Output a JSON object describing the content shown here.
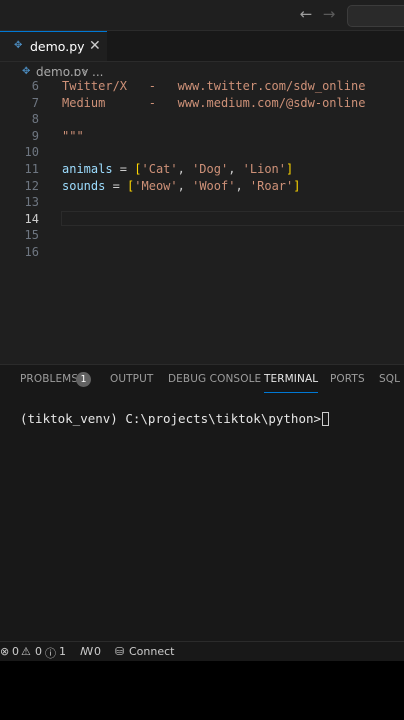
{
  "titlebar": {
    "back_icon": "←",
    "forward_icon": "→"
  },
  "tab": {
    "filename": "demo.py",
    "close_icon": "✕",
    "file_icon": "✥"
  },
  "breadcrumb": {
    "file": "demo.py",
    "separator": "›",
    "more": "..."
  },
  "editor": {
    "active_line": "14",
    "lines": [
      {
        "n": "6",
        "tokens": [
          {
            "c": "tk-doc",
            "t": "Twitter/X   -   www.twitter.com/sdw_online"
          }
        ]
      },
      {
        "n": "7",
        "tokens": [
          {
            "c": "tk-doc",
            "t": "Medium      -   www.medium.com/@sdw-online"
          }
        ]
      },
      {
        "n": "8",
        "tokens": []
      },
      {
        "n": "9",
        "tokens": [
          {
            "c": "tk-doc",
            "t": "\"\"\""
          }
        ]
      },
      {
        "n": "10",
        "tokens": []
      },
      {
        "n": "11",
        "tokens": [
          {
            "c": "tk-var",
            "t": "animals"
          },
          {
            "c": "tk-op",
            "t": " = "
          },
          {
            "c": "tk-br",
            "t": "["
          },
          {
            "c": "tk-str",
            "t": "'Cat'"
          },
          {
            "c": "tk-pun",
            "t": ", "
          },
          {
            "c": "tk-str",
            "t": "'Dog'"
          },
          {
            "c": "tk-pun",
            "t": ", "
          },
          {
            "c": "tk-str",
            "t": "'Lion'"
          },
          {
            "c": "tk-br",
            "t": "]"
          }
        ]
      },
      {
        "n": "12",
        "tokens": [
          {
            "c": "tk-var",
            "t": "sounds"
          },
          {
            "c": "tk-op",
            "t": " = "
          },
          {
            "c": "tk-br",
            "t": "["
          },
          {
            "c": "tk-str",
            "t": "'Meow'"
          },
          {
            "c": "tk-pun",
            "t": ", "
          },
          {
            "c": "tk-str",
            "t": "'Woof'"
          },
          {
            "c": "tk-pun",
            "t": ", "
          },
          {
            "c": "tk-str",
            "t": "'Roar'"
          },
          {
            "c": "tk-br",
            "t": "]"
          }
        ]
      },
      {
        "n": "13",
        "tokens": []
      },
      {
        "n": "14",
        "tokens": []
      },
      {
        "n": "15",
        "tokens": []
      },
      {
        "n": "16",
        "tokens": []
      }
    ]
  },
  "panel": {
    "tabs": {
      "problems": "PROBLEMS",
      "problems_count": "1",
      "output": "OUTPUT",
      "debug_console": "DEBUG CONSOLE",
      "terminal": "TERMINAL",
      "ports": "PORTS",
      "sql": "SQL C"
    },
    "terminal_prompt": "(tiktok_venv) C:\\projects\\tiktok\\python>"
  },
  "statusbar": {
    "errors_icon": "⊗",
    "errors": "0",
    "warnings_icon": "⚠",
    "warnings": "0",
    "info_icon": "ⓘ",
    "info": "1",
    "ports_icon": "ꟿ",
    "ports": "0",
    "connect_icon": "⛁",
    "connect": "Connect"
  },
  "colors": {
    "accent": "#0078d4",
    "editor_bg": "#1f1f1f",
    "panel_bg": "#181818",
    "string": "#ce9178",
    "variable": "#9cdcfe",
    "bracket": "#ffd700"
  }
}
